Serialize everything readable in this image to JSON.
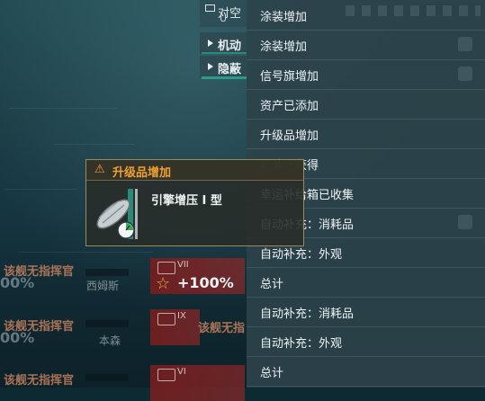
{
  "left_menu": {
    "row0_label": "对空",
    "row0_sub": "U",
    "row1_label": "机动",
    "row2_label": "隐蔽"
  },
  "notifications": [
    "涂装增加",
    "涂装增加",
    "信号旗增加",
    "资产已添加",
    "升级品增加",
    "石油已获得",
    "幸运补给箱已收集",
    "自动补充：消耗品",
    "自动补充：外观",
    "总计",
    "自动补充：消耗品",
    "自动补充：外观",
    "总计"
  ],
  "popup": {
    "title": "升级品增加",
    "warning_icon": "⚠",
    "item_name": "引擎增压 I 型",
    "icon": "engine-boost-upgrade-icon"
  },
  "background_rows": [
    {
      "player": "该舰无指挥官",
      "ship": "西姆斯",
      "percent": "00%",
      "card_tier": "VII",
      "card_percent": "+100%"
    },
    {
      "player": "该舰无指挥官",
      "ship": "本森",
      "percent": "00%",
      "card_tier": "IX",
      "card_percent": "",
      "player2": "该舰无指"
    },
    {
      "player": "该舰无指挥官",
      "ship": "",
      "percent": "",
      "card_tier": "VI",
      "card_percent": ""
    }
  ],
  "colors": {
    "accent_teal": "#2c9a86",
    "warning_orange": "#f0a030",
    "popup_border": "#9a8a5a"
  }
}
